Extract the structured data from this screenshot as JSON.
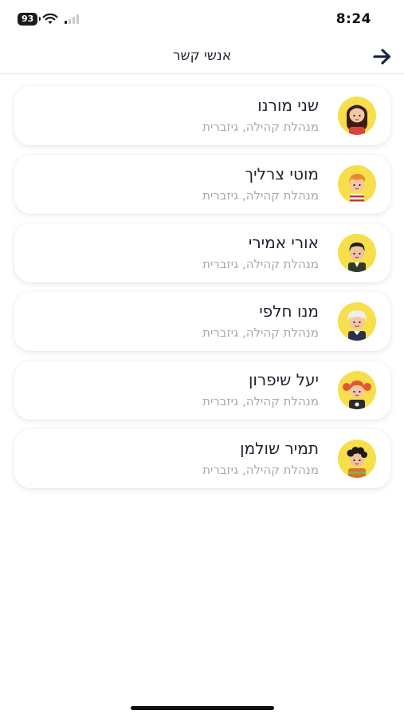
{
  "status_bar": {
    "time": "8:24",
    "battery_level": "93"
  },
  "header": {
    "title": "אנשי קשר",
    "back_icon": "arrow-right-icon"
  },
  "contacts": [
    {
      "name": "שני מורנו",
      "role": "מנהלת קהילה, גיזברית",
      "avatar": "woman-dark-hair-avatar"
    },
    {
      "name": "מוטי צרליך",
      "role": "מנהלת קהילה, גיזברית",
      "avatar": "man-orange-hair-avatar"
    },
    {
      "name": "אורי אמירי",
      "role": "מנהלת קהילה, גיזברית",
      "avatar": "man-dark-hair-avatar"
    },
    {
      "name": "מנו חלפי",
      "role": "מנהלת קהילה, גיזברית",
      "avatar": "older-man-white-hair-avatar"
    },
    {
      "name": "יעל שיפרון",
      "role": "מנהלת קהילה, גיזברית",
      "avatar": "girl-red-pigtails-avatar"
    },
    {
      "name": "תמיר שולמן",
      "role": "מנהלת קהילה, גיזברית",
      "avatar": "man-curly-hair-avatar"
    }
  ],
  "colors": {
    "avatar_bg": "#f6df4a",
    "title_text": "#1e2233",
    "subtitle_text": "#a6a8b0",
    "accent_navy": "#1c2340"
  }
}
